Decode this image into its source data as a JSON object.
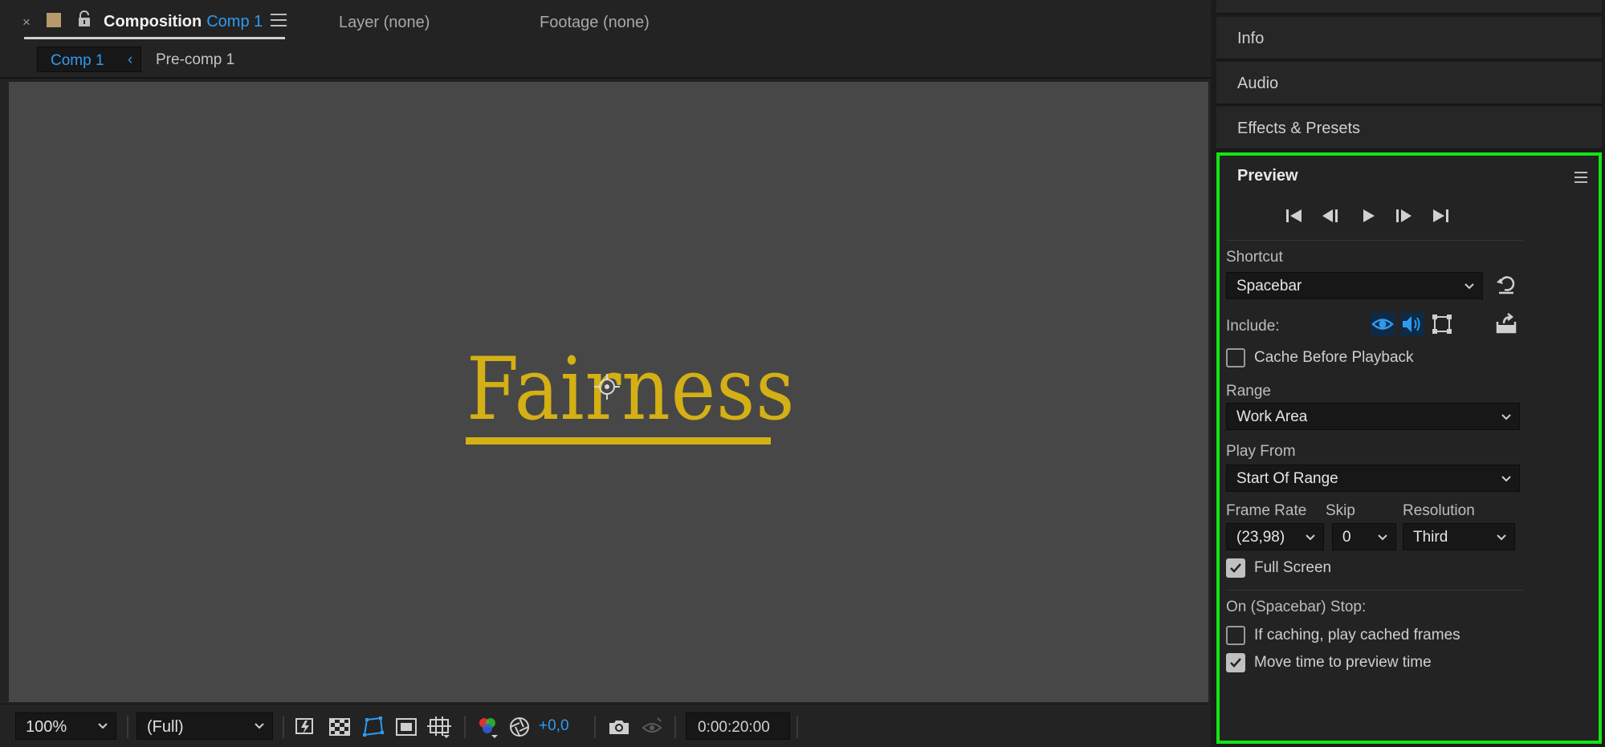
{
  "composition_tabs": {
    "close_glyph": "×",
    "title": "Composition",
    "comp_name": "Comp 1",
    "layer_tab": "Layer (none)",
    "footage_tab": "Footage (none)"
  },
  "breadcrumbs": {
    "active": "Comp 1",
    "chevron": "‹",
    "other": "Pre-comp 1"
  },
  "viewer": {
    "text": "Fairness",
    "text_color": "#d4b015",
    "background": "#474747"
  },
  "viewer_toolbar": {
    "zoom": "100%",
    "resolution": "(Full)",
    "exposure": "+0,0",
    "timecode": "0:00:20:00"
  },
  "side_panels": {
    "info": "Info",
    "audio": "Audio",
    "effects": "Effects & Presets"
  },
  "preview": {
    "title": "Preview",
    "shortcut_label": "Shortcut",
    "shortcut_value": "Spacebar",
    "include_label": "Include:",
    "cache_before_playback": "Cache Before Playback",
    "range_label": "Range",
    "range_value": "Work Area",
    "play_from_label": "Play From",
    "play_from_value": "Start Of Range",
    "frame_rate_label": "Frame Rate",
    "frame_rate_value": "(23,98)",
    "skip_label": "Skip",
    "skip_value": "0",
    "resolution_label": "Resolution",
    "resolution_value": "Third",
    "full_screen": "Full Screen",
    "on_stop_label": "On (Spacebar) Stop:",
    "if_caching": "If caching, play cached frames",
    "move_time": "Move time to preview time",
    "highlight_color": "#14e414",
    "accent_color": "#2f9bf0"
  }
}
